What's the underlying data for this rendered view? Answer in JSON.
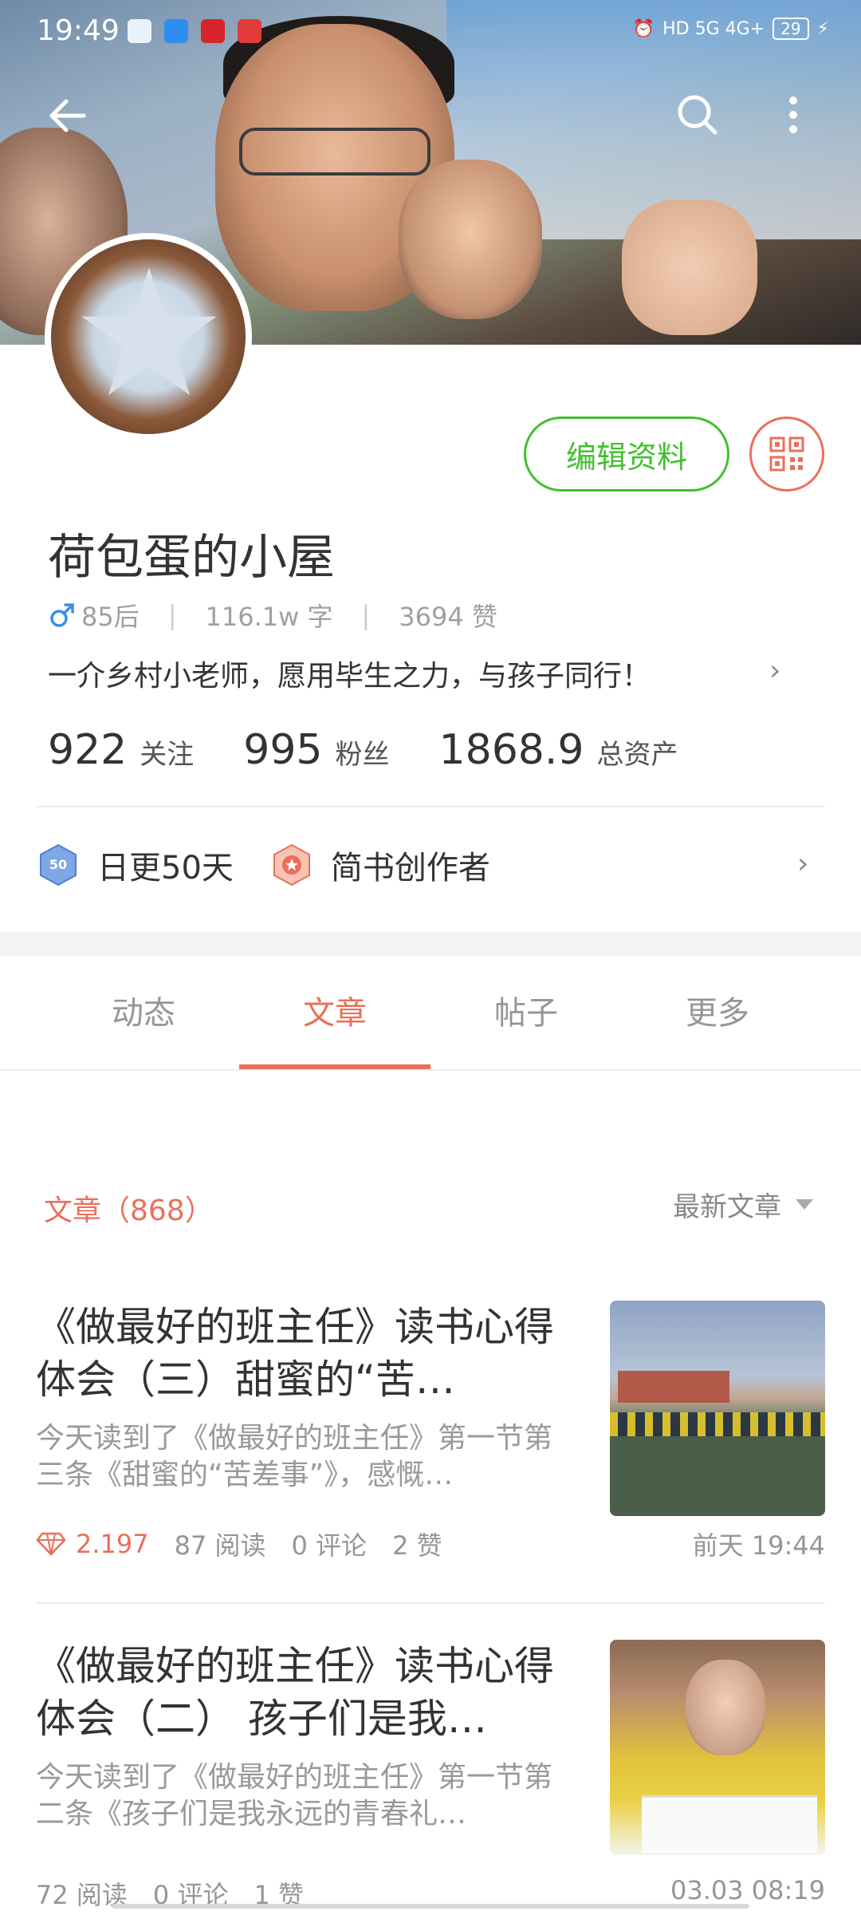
{
  "status_bar": {
    "time": "19:49",
    "network": "HD 5G 4G+",
    "battery": "29",
    "notification_icons": [
      "chat-app-icon",
      "message-app-icon",
      "news-app-icon",
      "heart-app-icon"
    ]
  },
  "profile": {
    "name": "荷包蛋的小屋",
    "age_group": "85后",
    "words": "116.1w 字",
    "likes": "3694 赞",
    "bio": "一介乡村小老师，愿用毕生之力，与孩子同行！",
    "edit_label": "编辑资料",
    "stats": [
      {
        "num": "922",
        "label": "关注"
      },
      {
        "num": "995",
        "label": "粉丝"
      },
      {
        "num": "1868.9",
        "label": "总资产"
      }
    ],
    "badges": [
      {
        "label": "日更50天",
        "icon_text": "50"
      },
      {
        "label": "简书创作者"
      }
    ]
  },
  "tabs": [
    {
      "label": "动态"
    },
    {
      "label": "文章"
    },
    {
      "label": "帖子"
    },
    {
      "label": "更多"
    }
  ],
  "articles_section": {
    "title": "文章（868）",
    "sort_label": "最新文章"
  },
  "articles": [
    {
      "title": "《做最好的班主任》读书心得体会（三）甜蜜的“苦…",
      "desc": "今天读到了《做最好的班主任》第一节第三条《甜蜜的“苦差事”》，感慨…",
      "diamond": "2.197",
      "reads": "87 阅读",
      "comments": "0 评论",
      "likes": "2 赞",
      "time": "前天 19:44"
    },
    {
      "title": "《做最好的班主任》读书心得体会（二） 孩子们是我…",
      "desc": "今天读到了《做最好的班主任》第一节第二条《孩子们是我永远的青春礼…",
      "reads": "72 阅读",
      "comments": "0 评论",
      "likes": "1 赞",
      "time": "03.03 08:19"
    }
  ],
  "colors": {
    "accent": "#ea6f5a",
    "edit_green": "#42c02e",
    "muted_text": "#969696"
  }
}
